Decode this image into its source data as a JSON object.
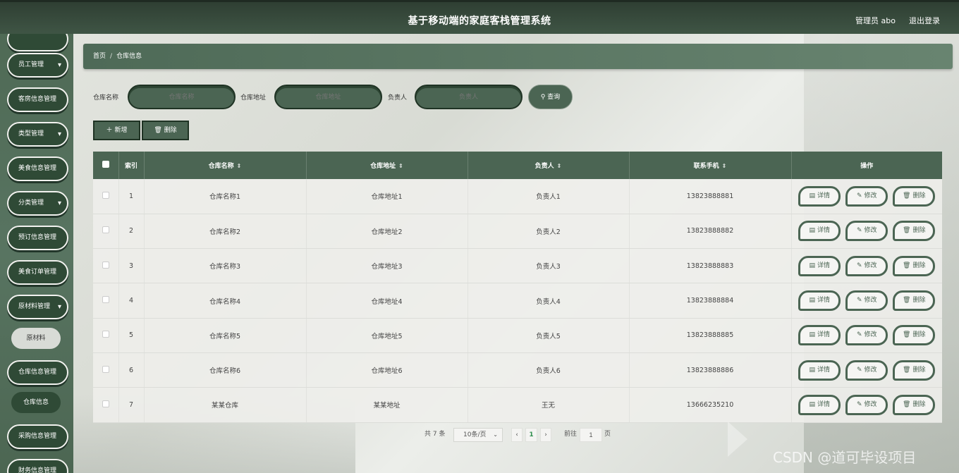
{
  "header": {
    "title": "基于移动端的家庭客栈管理系统",
    "admin": "管理员 abo",
    "logout": "退出登录"
  },
  "sidebar": {
    "items": [
      {
        "label": "员工管理",
        "has_chevron": true
      },
      {
        "label": "客房信息管理",
        "has_chevron": false
      },
      {
        "label": "类型管理",
        "has_chevron": true
      },
      {
        "label": "美食信息管理",
        "has_chevron": false
      },
      {
        "label": "分类管理",
        "has_chevron": true
      },
      {
        "label": "预订信息管理",
        "has_chevron": false
      },
      {
        "label": "美食订单管理",
        "has_chevron": false
      },
      {
        "label": "原材料管理",
        "has_chevron": true
      },
      {
        "label": "原材料",
        "sub": true,
        "active": true
      },
      {
        "label": "仓库信息管理",
        "has_chevron": false
      },
      {
        "label": "仓库信息",
        "sub": true
      },
      {
        "label": "采购信息管理",
        "has_chevron": false
      },
      {
        "label": "财务信息管理",
        "has_chevron": false
      }
    ],
    "chevron": "▾"
  },
  "breadcrumb": {
    "home": "首页",
    "separator": "/",
    "current": "仓库信息"
  },
  "search": {
    "name_label": "仓库名称",
    "name_placeholder": "仓库名称",
    "address_label": "仓库地址",
    "address_placeholder": "仓库地址",
    "person_label": "负责人",
    "person_placeholder": "负责人",
    "query_button": "查询",
    "query_icon": "search-icon"
  },
  "actions": {
    "add": "新增",
    "add_icon": "plus-icon",
    "delete": "删除",
    "delete_icon": "trash-icon"
  },
  "table": {
    "columns": [
      "索引",
      "仓库名称",
      "仓库地址",
      "负责人",
      "联系手机",
      "操作"
    ],
    "sortable": [
      false,
      true,
      true,
      true,
      true,
      false
    ],
    "sort_glyph": "⇕",
    "rows": [
      {
        "index": "1",
        "name": "仓库名称1",
        "address": "仓库地址1",
        "person": "负责人1",
        "phone": "13823888881"
      },
      {
        "index": "2",
        "name": "仓库名称2",
        "address": "仓库地址2",
        "person": "负责人2",
        "phone": "13823888882"
      },
      {
        "index": "3",
        "name": "仓库名称3",
        "address": "仓库地址3",
        "person": "负责人3",
        "phone": "13823888883"
      },
      {
        "index": "4",
        "name": "仓库名称4",
        "address": "仓库地址4",
        "person": "负责人4",
        "phone": "13823888884"
      },
      {
        "index": "5",
        "name": "仓库名称5",
        "address": "仓库地址5",
        "person": "负责人5",
        "phone": "13823888885"
      },
      {
        "index": "6",
        "name": "仓库名称6",
        "address": "仓库地址6",
        "person": "负责人6",
        "phone": "13823888886"
      },
      {
        "index": "7",
        "name": "某某仓库",
        "address": "某某地址",
        "person": "王无",
        "phone": "13666235210"
      }
    ],
    "ops": {
      "detail": "详情",
      "edit": "修改",
      "delete": "删除"
    }
  },
  "pagination": {
    "total": "共 7 条",
    "page_size": "10条/页",
    "prev": "‹",
    "current_page": "1",
    "next": "›",
    "goto_label": "前往",
    "goto_value": "1",
    "page_suffix": "页"
  },
  "watermark": "CSDN @道可毕设项目",
  "colors": {
    "primary": "#4b6553",
    "topbar": "#344838",
    "sidebar": "#587461"
  }
}
